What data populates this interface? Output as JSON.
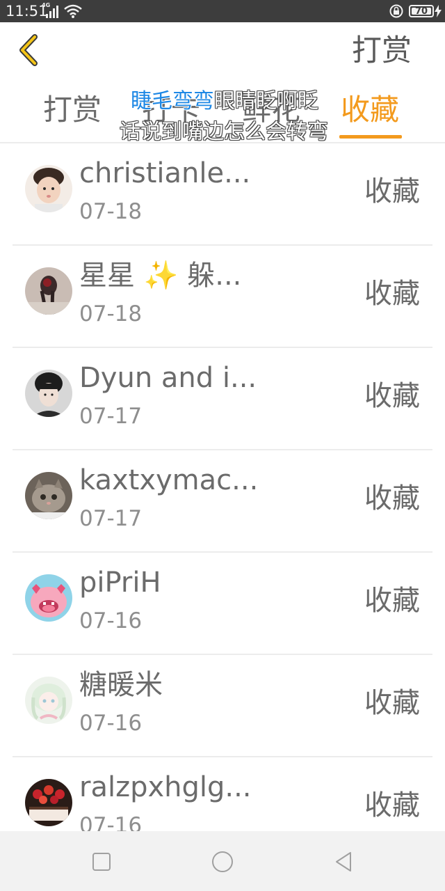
{
  "status_bar": {
    "time": "11:51",
    "network": "4G",
    "battery": "70"
  },
  "header": {
    "title": "打赏"
  },
  "tabs": [
    {
      "label": "打赏",
      "active": false
    },
    {
      "label": "打卡",
      "active": false
    },
    {
      "label": "鲜花",
      "active": false
    },
    {
      "label": "收藏",
      "active": true
    }
  ],
  "danmaku": {
    "line1_highlight": "睫毛弯弯",
    "line1_rest": "眼睛眨啊眨",
    "line2": "话说到嘴边怎么会转弯"
  },
  "records": [
    {
      "name": "christianle...",
      "date": "07-18",
      "action": "收藏"
    },
    {
      "name": "星星",
      "emoji": "✨",
      "name_suffix": "躲...",
      "date": "07-18",
      "action": "收藏"
    },
    {
      "name": "Dyun and i...",
      "date": "07-17",
      "action": "收藏"
    },
    {
      "name": "kaxtxymac...",
      "date": "07-17",
      "action": "收藏"
    },
    {
      "name": "piPriH",
      "date": "07-16",
      "action": "收藏"
    },
    {
      "name": "糖暖米",
      "date": "07-16",
      "action": "收藏"
    },
    {
      "name": "ralzpxhglg...",
      "date": "07-16",
      "action": "收藏"
    }
  ],
  "colors": {
    "accent": "#f39a1d",
    "status_bar": "#3d3d3d",
    "danmaku_highlight": "#1e88e5"
  },
  "icons": {
    "back": "chevron-left-icon",
    "nav": [
      "square-icon",
      "circle-icon",
      "triangle-back-icon"
    ]
  }
}
